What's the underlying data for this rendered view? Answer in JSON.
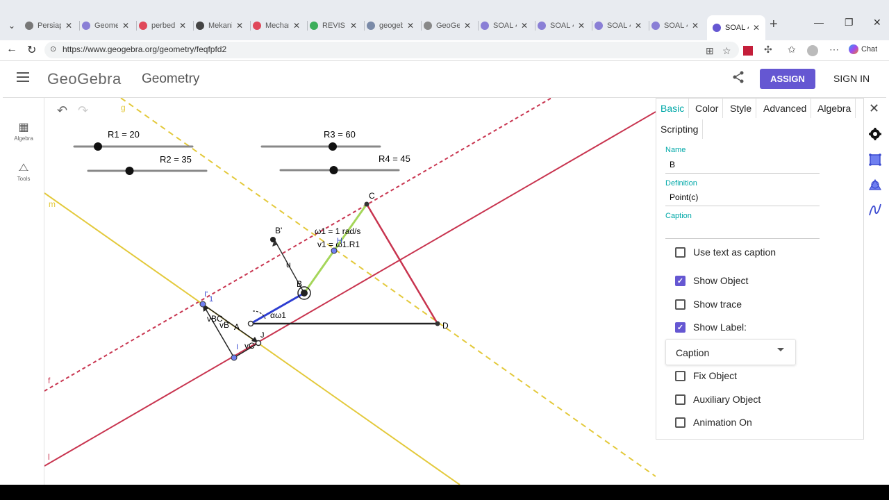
{
  "browser": {
    "tabs": [
      {
        "label": "Persiapan",
        "fav": "#777"
      },
      {
        "label": "Geometry",
        "fav": "#8a7fd6"
      },
      {
        "label": "perbedaan",
        "fav": "#e0485a"
      },
      {
        "label": "Mekanika",
        "fav": "#444"
      },
      {
        "label": "Mechanics",
        "fav": "#e0485a"
      },
      {
        "label": "REVISI",
        "fav": "#3cae5b"
      },
      {
        "label": "geogebra",
        "fav": "#7a8aa8"
      },
      {
        "label": "GeoGebra",
        "fav": "#888"
      },
      {
        "label": "SOAL 4",
        "fav": "#8a7fd6"
      },
      {
        "label": "SOAL 4",
        "fav": "#8a7fd6"
      },
      {
        "label": "SOAL 4",
        "fav": "#8a7fd6"
      },
      {
        "label": "SOAL 4",
        "fav": "#8a7fd6"
      }
    ],
    "active_tab": {
      "label": "SOAL 4",
      "fav": "#6557d2"
    },
    "url": "https://www.geogebra.org/geometry/feqfpfd2",
    "chat_label": "Chat",
    "close_glyph": "✕",
    "newtab_glyph": "+",
    "menu_glyph": "⌄",
    "back_glyph": "←",
    "reload_glyph": "↻",
    "min_glyph": "—",
    "restore_glyph": "❐",
    "lock_glyph": "⊙"
  },
  "header": {
    "logo": "GeoGebra",
    "title": "Geometry",
    "assign_label": "ASSIGN",
    "signin_label": "SIGN IN",
    "share_glyph": "⋖"
  },
  "rail": {
    "algebra_label": "Algebra",
    "tools_label": "Tools",
    "algebra_glyph": "▦",
    "tools_glyph": "⧍"
  },
  "toolbar": {
    "undo_glyph": "↶",
    "redo_glyph": "↷"
  },
  "canvas": {
    "sliders": [
      {
        "label": "R1 = 20",
        "value": 20
      },
      {
        "label": "R2 = 35",
        "value": 35
      },
      {
        "label": "R3 = 60",
        "value": 60
      },
      {
        "label": "R4 = 45",
        "value": 45
      }
    ],
    "points": {
      "A": "A",
      "B": "B",
      "C": "C",
      "D": "D",
      "Bprime": "B'",
      "H": "H",
      "I": "I",
      "Iprime": "I'",
      "J": "J",
      "one": "1"
    },
    "vectors": {
      "u": "u",
      "vBC": "vBC",
      "vB": "vB",
      "vC": "vC"
    },
    "annotations": {
      "omega": "ω1 = 1 rad/s",
      "velocity": "v1 = ω1.R1",
      "angle": "αω1"
    },
    "line_labels": {
      "g": "g",
      "m": "m",
      "f": "f",
      "l": "l"
    },
    "colors": {
      "red_line": "#c8344f",
      "yellow_line": "#e3c93b",
      "crank": "#2d3dd1",
      "coupler": "#a5d65a",
      "ground": "#222222"
    }
  },
  "panel": {
    "tabs": [
      "Basic",
      "Color",
      "Style",
      "Advanced",
      "Algebra",
      "Scripting"
    ],
    "active_tab": "Basic",
    "name_label": "Name",
    "name_value": "B",
    "definition_label": "Definition",
    "definition_value": "Point(c)",
    "caption_label": "Caption",
    "caption_value": "",
    "checkboxes": [
      {
        "label": "Use text as caption",
        "checked": false
      },
      {
        "label": "Show Object",
        "checked": true
      },
      {
        "label": "Show trace",
        "checked": false
      },
      {
        "label": "Show Label:",
        "checked": true
      },
      {
        "label": "Fix Object",
        "checked": false
      },
      {
        "label": "Auxiliary Object",
        "checked": false
      },
      {
        "label": "Animation On",
        "checked": false
      }
    ],
    "label_mode": "Caption",
    "accent": "#6557d2",
    "check_glyph": "✓"
  }
}
